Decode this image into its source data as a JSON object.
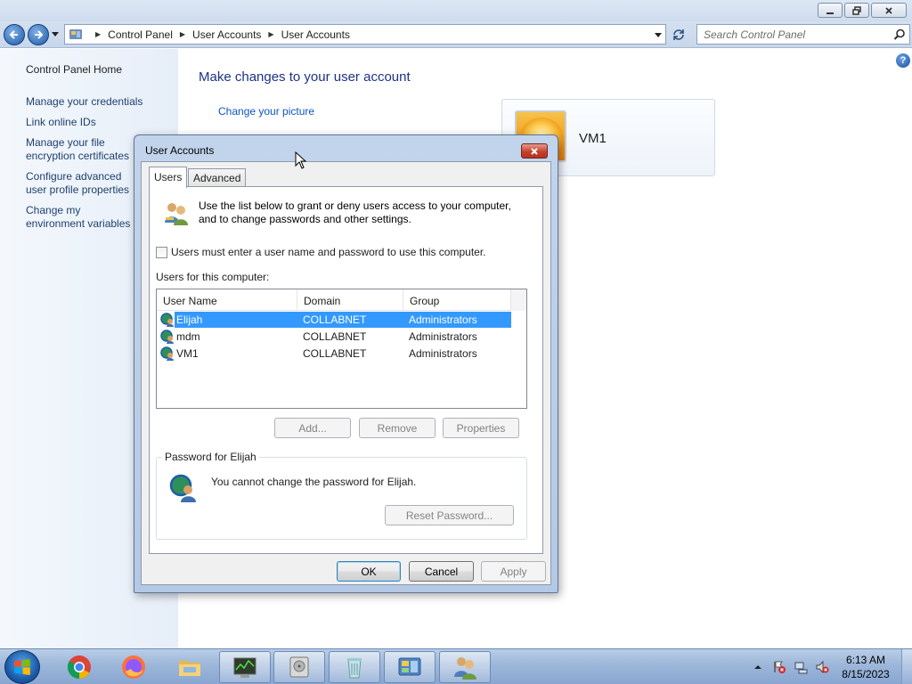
{
  "explorer": {
    "breadcrumb": [
      "Control Panel",
      "User Accounts",
      "User Accounts"
    ],
    "search_placeholder": "Search Control Panel",
    "left_nav": [
      {
        "label": "Control Panel Home"
      },
      {
        "label": "Manage your credentials"
      },
      {
        "label": "Link online IDs"
      },
      {
        "label": "Manage your file encryption certificates"
      },
      {
        "label": "Configure advanced user profile properties"
      },
      {
        "label": "Change my environment variables"
      }
    ],
    "content_title": "Make changes to your user account",
    "change_picture_link": "Change your picture",
    "user_card_name": "VM1"
  },
  "dialog": {
    "title": "User Accounts",
    "tabs": [
      {
        "label": "Users",
        "active": true
      },
      {
        "label": "Advanced",
        "active": false
      }
    ],
    "info_text": "Use the list below to grant or deny users access to your computer, and to change passwords and other settings.",
    "require_login_checkbox": {
      "label": "Users must enter a user name and password to use this computer.",
      "checked": false
    },
    "users_label": "Users for this computer:",
    "columns": [
      "User Name",
      "Domain",
      "Group"
    ],
    "rows": [
      {
        "user": "Elijah",
        "domain": "COLLABNET",
        "group": "Administrators",
        "selected": true
      },
      {
        "user": "mdm",
        "domain": "COLLABNET",
        "group": "Administrators",
        "selected": false
      },
      {
        "user": "VM1",
        "domain": "COLLABNET",
        "group": "Administrators",
        "selected": false
      }
    ],
    "buttons": {
      "add": "Add...",
      "remove": "Remove",
      "properties": "Properties"
    },
    "password_group_label": "Password for Elijah",
    "password_text": "You cannot change the password for Elijah.",
    "reset_password": "Reset Password...",
    "ok": "OK",
    "cancel": "Cancel",
    "apply": "Apply"
  },
  "taskbar": {
    "apps": [
      "chrome-icon",
      "firefox-icon",
      "file-explorer-icon",
      "task-manager-icon",
      "disk-icon",
      "recycle-bin-icon",
      "control-panel-icon",
      "user-accounts-icon"
    ],
    "time": "6:13 AM",
    "date": "8/15/2023"
  },
  "colors": {
    "selection": "#3399ff",
    "link": "#0b55c4",
    "title_blue": "#1e3287"
  }
}
